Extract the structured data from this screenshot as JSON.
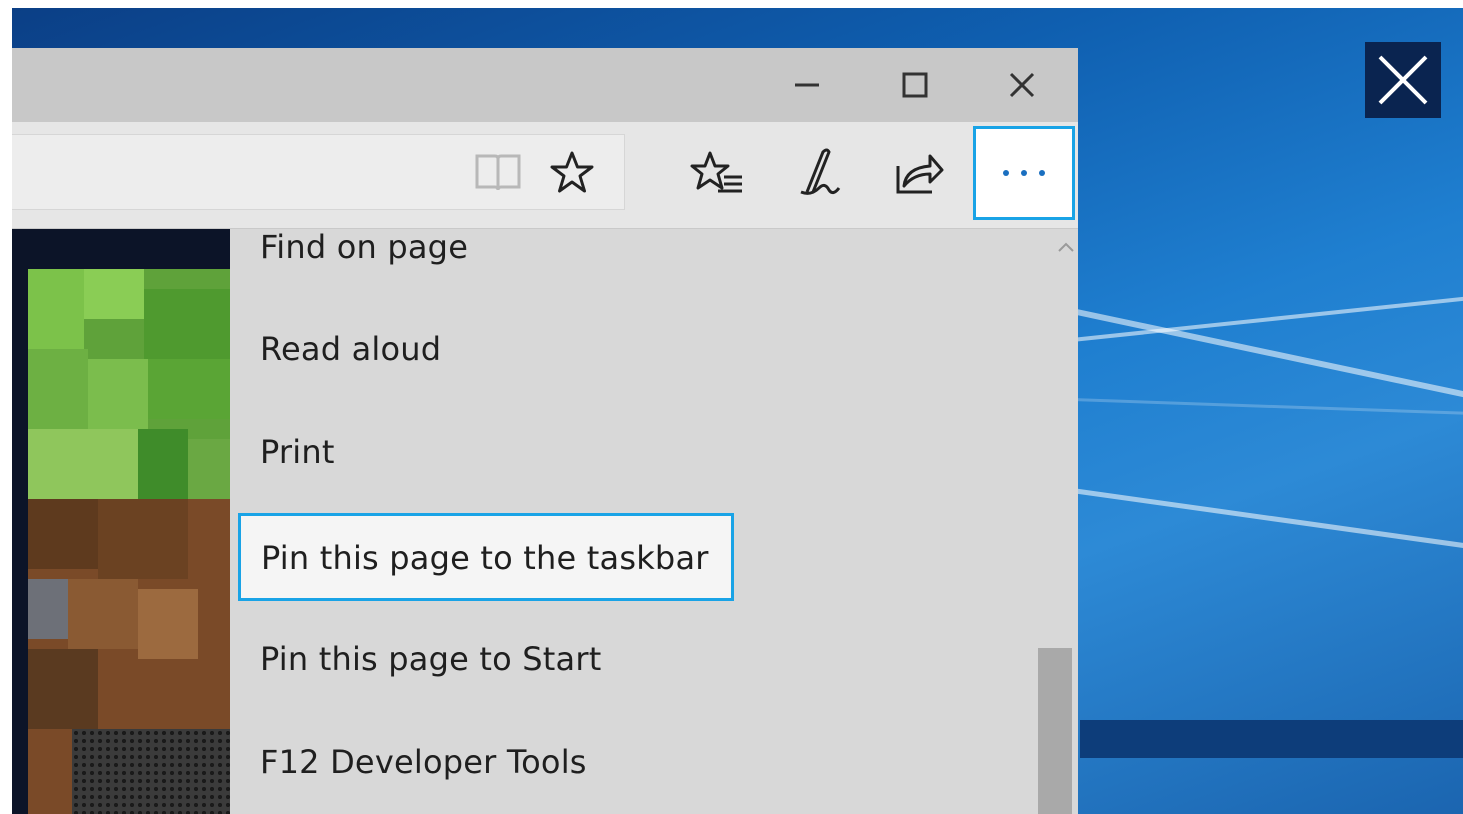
{
  "browser": {
    "window_controls": {
      "minimize_icon": "minimize-icon",
      "maximize_icon": "maximize-icon",
      "close_icon": "close-icon"
    },
    "toolbar": {
      "reading_view_icon": "reading-view-icon",
      "favorite_icon": "star-icon",
      "favorites_hub_icon": "favorites-list-icon",
      "web_note_icon": "pen-icon",
      "share_icon": "share-icon",
      "more_icon": "more-ellipsis-icon",
      "more_label": "···"
    }
  },
  "menu": {
    "items": [
      {
        "label": "Find on page"
      },
      {
        "label": "Read aloud"
      },
      {
        "label": "Print"
      },
      {
        "label": "Pin this page to the taskbar",
        "highlighted": true
      },
      {
        "label": "Pin this page to Start"
      },
      {
        "label": "F12 Developer Tools"
      }
    ]
  },
  "colors": {
    "highlight_border": "#19a3e6",
    "menu_background": "#d8d8d8",
    "desktop_blue": "#1f7fd0"
  }
}
